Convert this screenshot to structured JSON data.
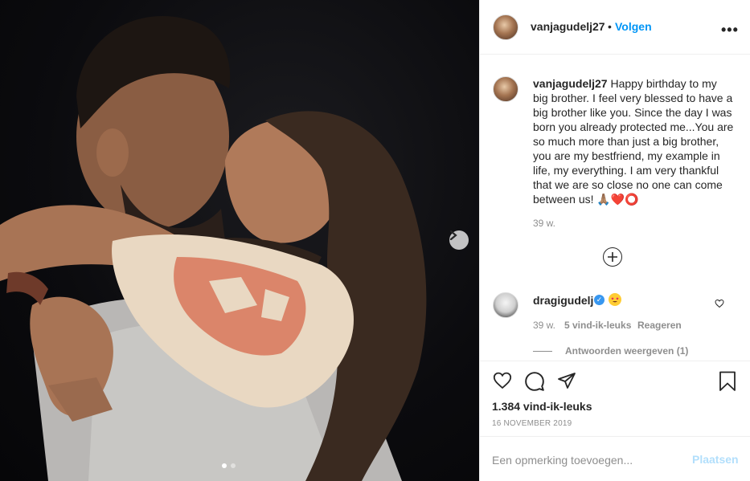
{
  "header": {
    "username": "vanjagudelj27",
    "separator": "•",
    "follow_label": "Volgen",
    "more_label": "•••"
  },
  "caption": {
    "username": "vanjagudelj27",
    "text": "Happy birthday to my big brother. I feel very blessed to have a big brother like you. Since the day I was born you already protected me...You are so much more than just a big brother, you are my bestfriend, my example in life, my everything. I am very thankful that we are so close no one can come between us! 🙏🏽❤️⭕",
    "time": "39 w."
  },
  "comment": {
    "username": "dragigudelj",
    "verified": true,
    "emoji": "star-struck-emoji",
    "time": "39 w.",
    "likes": "5 vind-ik-leuks",
    "reply_label": "Reageren",
    "view_replies": "Antwoorden weergeven (1)"
  },
  "actions": {
    "icons": [
      "heart-icon",
      "comment-icon",
      "share-icon",
      "bookmark-icon"
    ],
    "likes": "1.384 vind-ik-leuks",
    "date": "16 NOVEMBER 2019"
  },
  "comment_box": {
    "placeholder": "Een opmerking toevoegen...",
    "post_label": "Plaatsen"
  },
  "carousel": {
    "slides": 2,
    "active_slide": 1
  },
  "colors": {
    "accent": "#0095f6",
    "post_disabled": "#b2dffc",
    "muted": "#8e8e8e",
    "text": "#262626"
  }
}
